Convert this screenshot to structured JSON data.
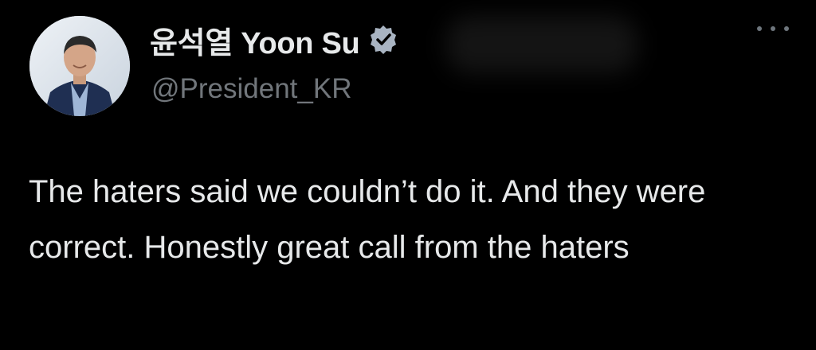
{
  "author": {
    "display_name": "윤석열 Yoon Su",
    "handle": "@President_KR",
    "verified": true,
    "avatar_icon": "profile-photo"
  },
  "tweet": {
    "text": "The haters said we couldn’t do it. And they were correct. Honestly great call from the haters"
  },
  "actions": {
    "more_icon": "more-options-icon"
  },
  "colors": {
    "background": "#000000",
    "primary_text": "#e7e9ea",
    "secondary_text": "#71767b",
    "verified_badge": "#a9b4c2"
  }
}
